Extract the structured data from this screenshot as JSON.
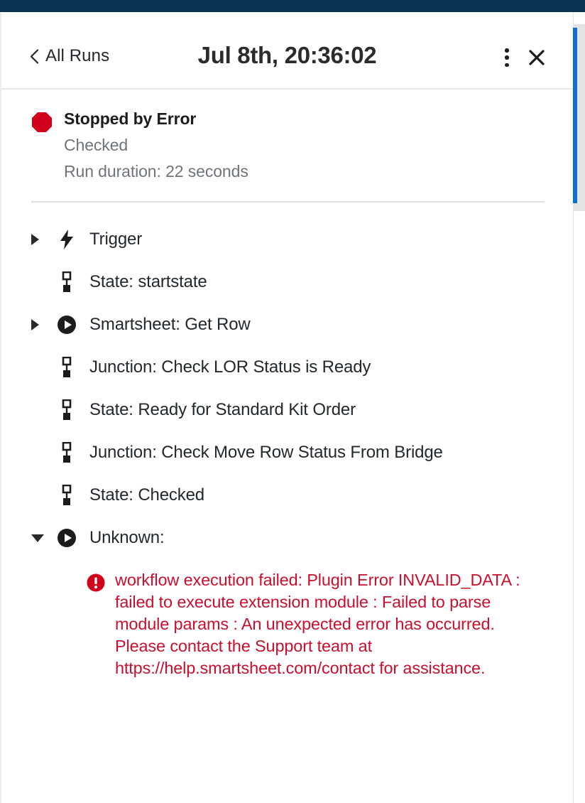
{
  "window": {
    "app_bar_color": "#0a3255"
  },
  "header": {
    "back_label": "All Runs",
    "back_icon": "chevron-left-icon",
    "title": "Jul 8th, 20:36:02",
    "more_icon": "kebab-menu-icon",
    "close_icon": "close-icon"
  },
  "scrollbar": {
    "thumb_color": "#0b6fd8",
    "track_color": "#e4e4e4"
  },
  "status": {
    "icon": "stop-octagon-icon",
    "icon_color": "#d0021b",
    "title": "Stopped by Error",
    "state": "Checked",
    "duration": "Run duration: 22 seconds"
  },
  "steps": [
    {
      "disclosure": "collapsed",
      "icon": "lightning-bolt-icon",
      "label": "Trigger"
    },
    {
      "disclosure": "none",
      "icon": "state-marker-icon",
      "label": "State: startstate"
    },
    {
      "disclosure": "collapsed",
      "icon": "play-circle-icon",
      "label": "Smartsheet: Get Row"
    },
    {
      "disclosure": "none",
      "icon": "state-marker-icon",
      "label": "Junction: Check LOR Status is Ready"
    },
    {
      "disclosure": "none",
      "icon": "state-marker-icon",
      "label": "State: Ready for Standard Kit Order"
    },
    {
      "disclosure": "none",
      "icon": "state-marker-icon",
      "label": "Junction: Check Move Row Status From Bridge"
    },
    {
      "disclosure": "none",
      "icon": "state-marker-icon",
      "label": "State: Checked"
    },
    {
      "disclosure": "expanded",
      "icon": "play-circle-icon",
      "label": "Unknown:"
    }
  ],
  "error": {
    "icon": "error-exclamation-icon",
    "color": "#c8102e",
    "message": "workflow execution failed: Plugin Error INVALID_DATA : failed to execute extension module : Failed to parse module params : An unexpected error has occurred. Please contact the Support team at https://help.smartsheet.com/contact for assistance."
  }
}
